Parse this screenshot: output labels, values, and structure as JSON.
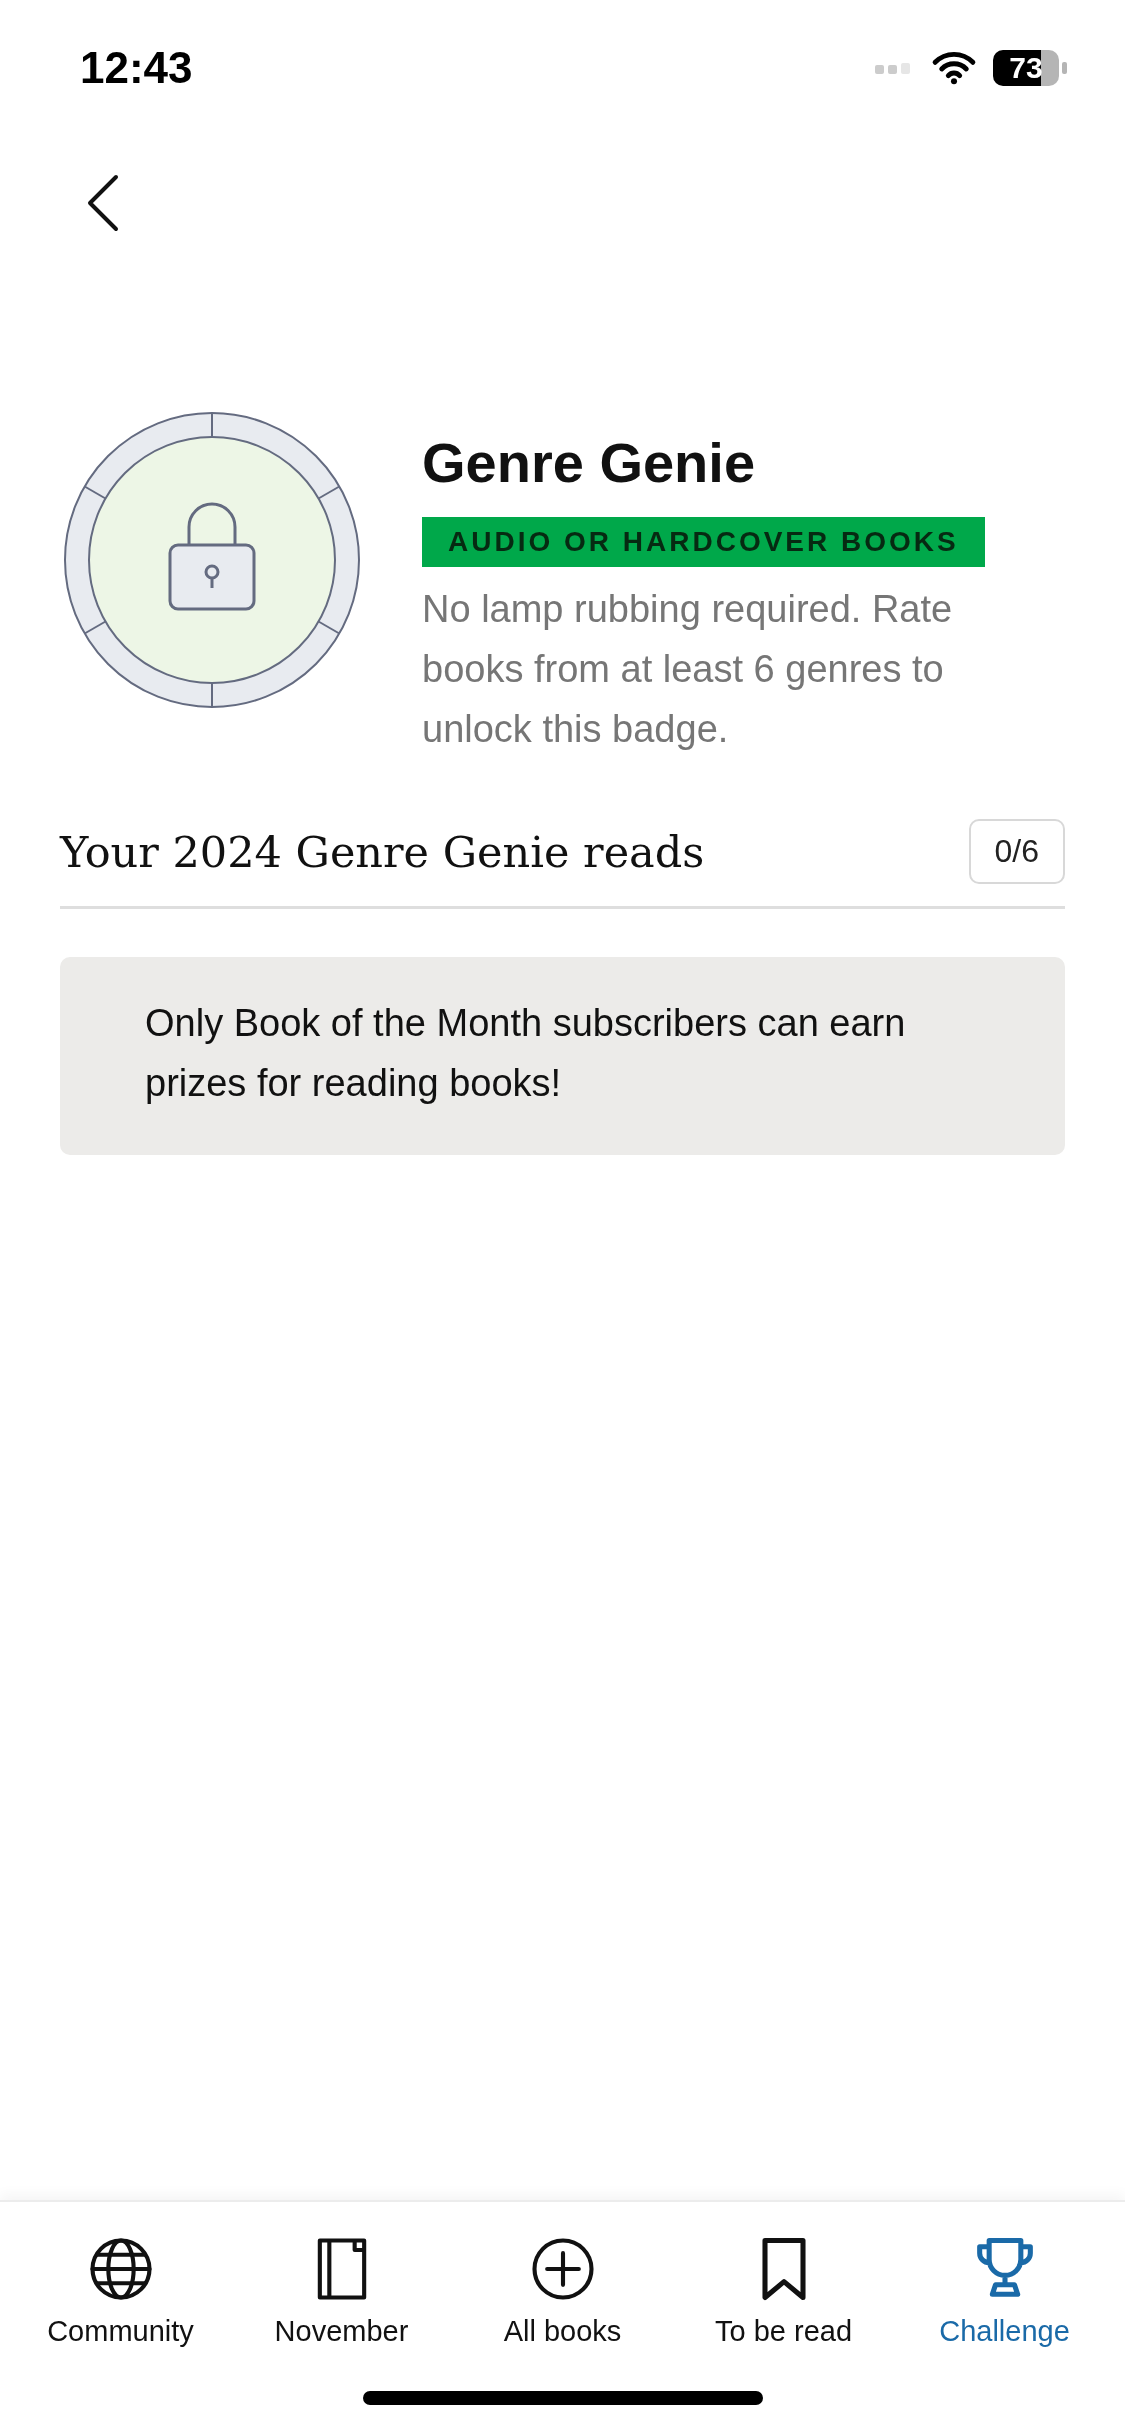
{
  "status_bar": {
    "time": "12:43",
    "battery": "73"
  },
  "badge": {
    "title": "Genre Genie",
    "tag": "AUDIO OR HARDCOVER BOOKS",
    "description": "No lamp rubbing required. Rate books from at least 6 genres to unlock this badge.",
    "locked": true
  },
  "reads": {
    "heading": "Your 2024 Genre Genie reads",
    "count": "0/6"
  },
  "notice": "Only Book of the Month subscribers can earn prizes for reading books!",
  "tabs": [
    {
      "kind": "globe",
      "label": "Community",
      "selected": false
    },
    {
      "kind": "book",
      "label": "November",
      "selected": false
    },
    {
      "kind": "plus",
      "label": "All books",
      "selected": false
    },
    {
      "kind": "bookmark",
      "label": "To be read",
      "selected": false
    },
    {
      "kind": "trophy",
      "label": "Challenge",
      "selected": true
    }
  ]
}
